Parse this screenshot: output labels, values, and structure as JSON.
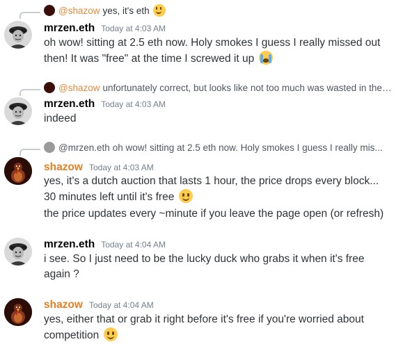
{
  "messages": [
    {
      "reply": {
        "mention": "@shazow",
        "text": "yes, it's eth",
        "emoji": "slightly-smiling-face"
      },
      "author": "mrzen.eth",
      "timestamp": "Today at 4:03 AM",
      "lines": [
        "oh wow!   sitting at 2.5 eth now.  Holy smokes   I guess I really missed out then!  It was \"free\" at the time I screwed it up"
      ],
      "trailing_emoji": "loudly-crying-face"
    },
    {
      "reply": {
        "mention": "@shazow",
        "text": "unfortunately correct, but looks like not too much was wasted in the ..."
      },
      "author": "mrzen.eth",
      "timestamp": "Today at 4:03 AM",
      "lines": [
        "indeed"
      ]
    },
    {
      "reply": {
        "mention": "@mrzen.eth",
        "text": "oh wow!   sitting at 2.5 eth now.  Holy smokes   I guess I really mis..."
      },
      "author": "shazow",
      "timestamp": "Today at 4:03 AM",
      "lines": [
        "yes, it's a dutch auction that lasts 1 hour, the price drops every block... 30 minutes left until it's free",
        "the price updates every ~minute if you leave the page open (or refresh)"
      ],
      "trailing_emoji": "slightly-smiling-face"
    },
    {
      "author": "mrzen.eth",
      "timestamp": "Today at 4:04 AM",
      "lines": [
        "i see.  So I just need to be the lucky duck who grabs it when it's free again ?"
      ]
    },
    {
      "author": "shazow",
      "timestamp": "Today at 4:04 AM",
      "lines": [
        "yes, either that or grab it right before it's free if you're worried about competition"
      ],
      "trailing_emoji": "slightly-smiling-face"
    }
  ],
  "colors": {
    "shazow_name": "#e67e22",
    "mrzen_name": "#060607",
    "timestamp": "#747f8d",
    "text": "#2e3338",
    "reply_line": "#c7ccd1"
  }
}
